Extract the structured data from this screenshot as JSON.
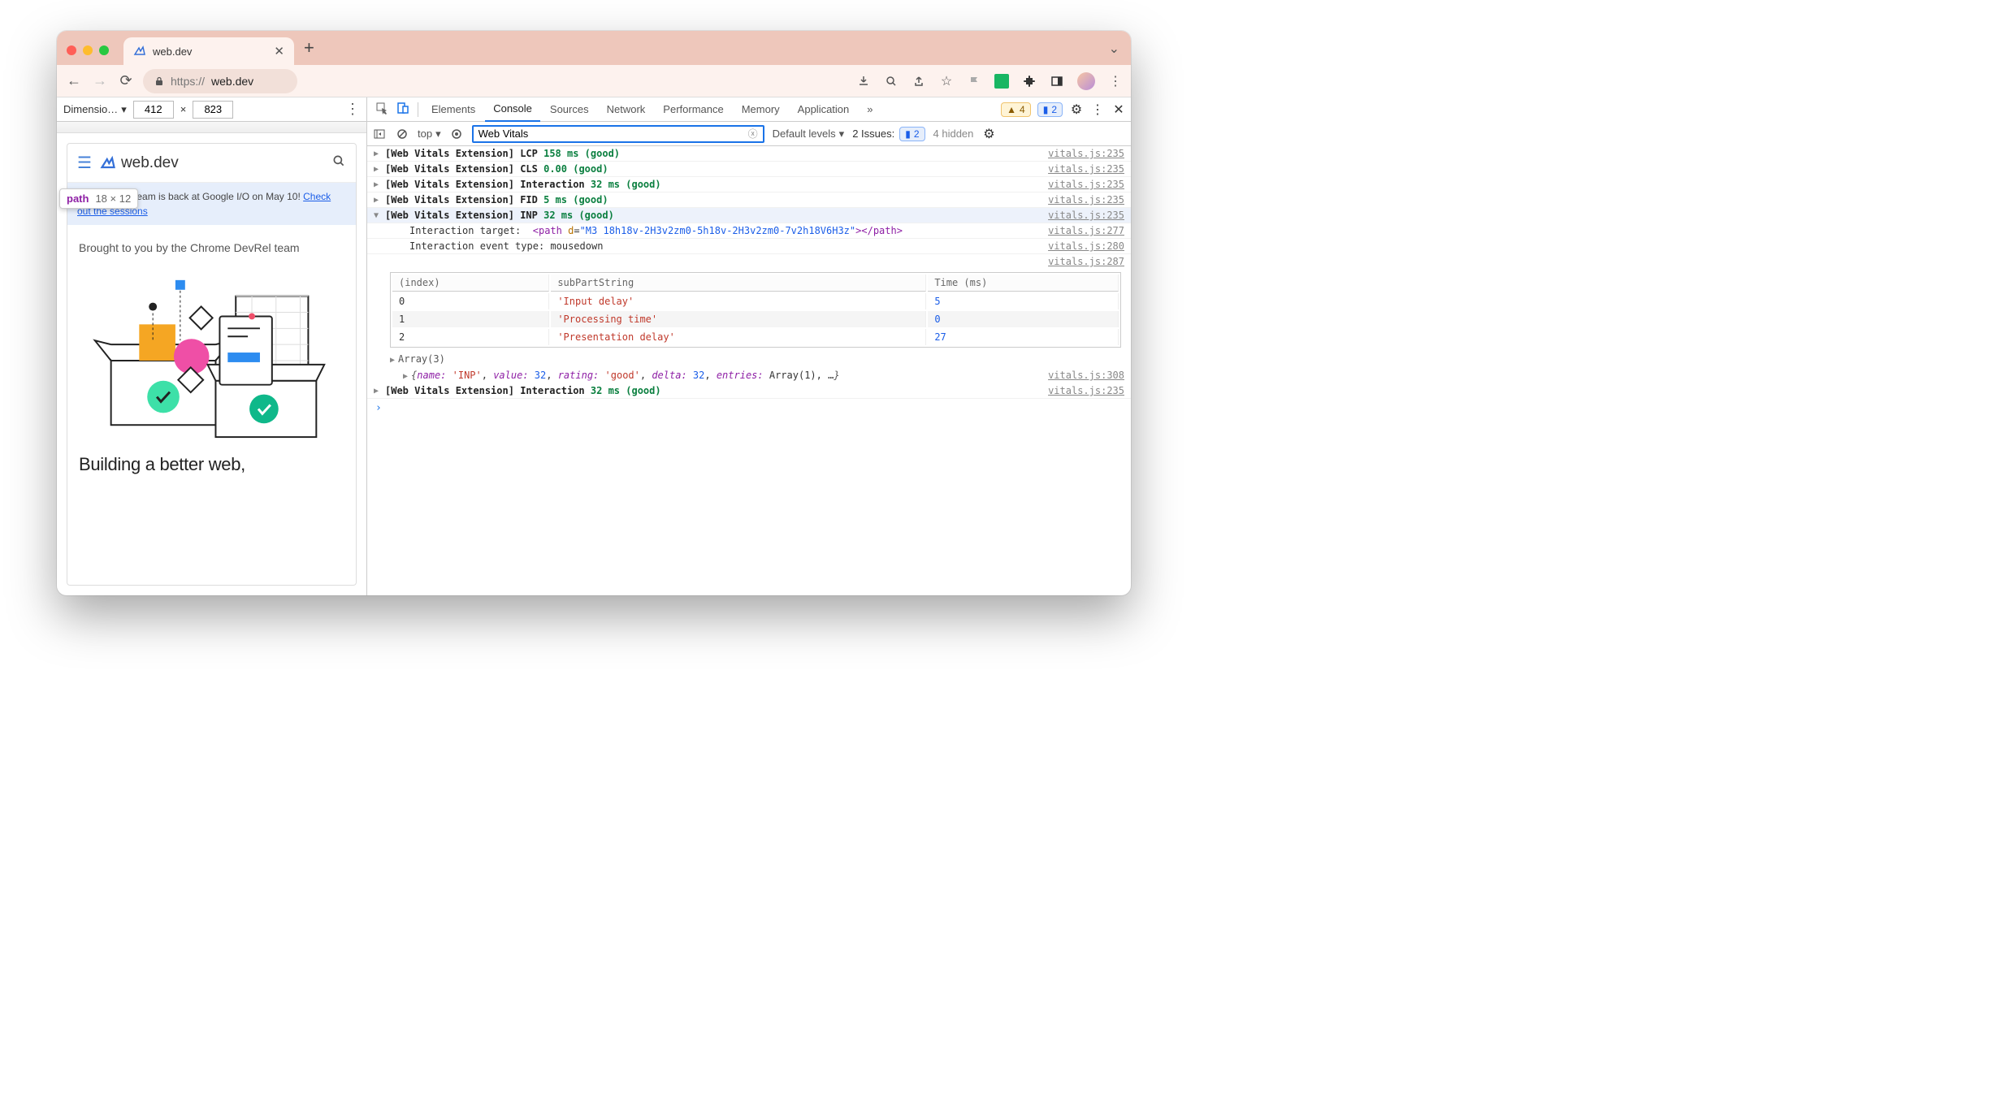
{
  "browser": {
    "tab_title": "web.dev",
    "url_scheme_indicator": "lock",
    "url_prefix": "https://",
    "url_host": "web.dev",
    "toolbar_icons": [
      "download-icon",
      "magnify-icon",
      "share-icon",
      "star-icon",
      "flag-icon",
      "extension-green",
      "puzzle-icon",
      "panel-icon",
      "avatar",
      "kebab-icon"
    ]
  },
  "device_toolbar": {
    "label": "Dimensio…",
    "width": "412",
    "x": "×",
    "height": "823"
  },
  "site": {
    "name": "web.dev",
    "banner_text": "The Chrome team is back at Google I/O on May 10! ",
    "banner_link": "Check out the sessions",
    "subtitle": "Brought to you by the Chrome DevRel team",
    "hero_title": "Building a better web,"
  },
  "tooltip": {
    "tag": "path",
    "dims": "18 × 12"
  },
  "devtools": {
    "tabs": [
      "Elements",
      "Console",
      "Sources",
      "Network",
      "Performance",
      "Memory",
      "Application"
    ],
    "active_tab": "Console",
    "warn_count": "4",
    "info_count": "2",
    "context": "top",
    "filter": "Web Vitals",
    "levels": "Default levels",
    "issues_label": "2 Issues:",
    "issues_count": "2",
    "hidden": "4 hidden",
    "logs": [
      {
        "prefix": "[Web Vitals Extension]",
        "metric": "LCP",
        "value": "158 ms (good)",
        "src": "vitals.js:235",
        "expanded": false
      },
      {
        "prefix": "[Web Vitals Extension]",
        "metric": "CLS",
        "value": "0.00 (good)",
        "src": "vitals.js:235",
        "expanded": false
      },
      {
        "prefix": "[Web Vitals Extension]",
        "metric": "Interaction",
        "value": "32 ms (good)",
        "src": "vitals.js:235",
        "expanded": false
      },
      {
        "prefix": "[Web Vitals Extension]",
        "metric": "FID",
        "value": "5 ms (good)",
        "src": "vitals.js:235",
        "expanded": false
      },
      {
        "prefix": "[Web Vitals Extension]",
        "metric": "INP",
        "value": "32 ms (good)",
        "src": "vitals.js:235",
        "expanded": true
      }
    ],
    "interaction_target_label": "Interaction target:",
    "interaction_target_tag": "path",
    "interaction_target_attr": "d",
    "interaction_target_val": "\"M3 18h18v-2H3v2zm0-5h18v-2H3v2zm0-7v2h18V6H3z\"",
    "interaction_target_src": "vitals.js:277",
    "interaction_event_label": "Interaction event type:",
    "interaction_event_value": "mousedown",
    "interaction_event_src": "vitals.js:280",
    "table_src": "vitals.js:287",
    "table_headers": [
      "(index)",
      "subPartString",
      "Time (ms)"
    ],
    "table_rows": [
      {
        "index": "0",
        "subPartString": "'Input delay'",
        "time": "5"
      },
      {
        "index": "1",
        "subPartString": "'Processing time'",
        "time": "0"
      },
      {
        "index": "2",
        "subPartString": "'Presentation delay'",
        "time": "27"
      }
    ],
    "array_label": "Array(3)",
    "object_summary": {
      "name_k": "name:",
      "name_v": "'INP'",
      "value_k": "value:",
      "value_v": "32",
      "rating_k": "rating:",
      "rating_v": "'good'",
      "delta_k": "delta:",
      "delta_v": "32",
      "entries_k": "entries:",
      "entries_v": "Array(1)",
      "ellipsis": "…",
      "src": "vitals.js:308"
    },
    "trailing_log": {
      "prefix": "[Web Vitals Extension]",
      "metric": "Interaction",
      "value": "32 ms (good)",
      "src": "vitals.js:235"
    }
  }
}
